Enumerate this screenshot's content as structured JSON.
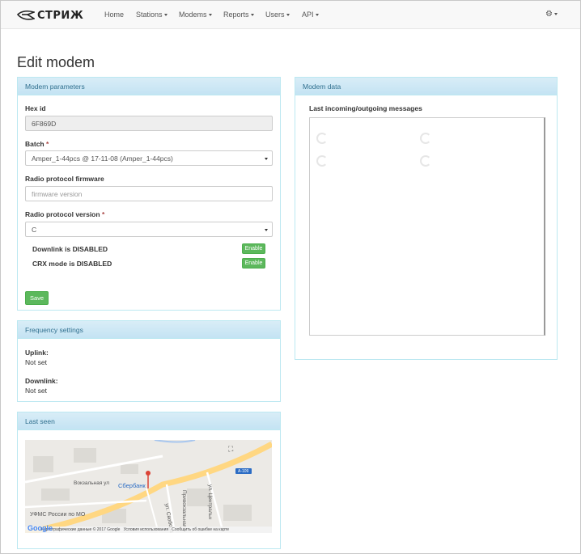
{
  "brand": {
    "name": "СТРИЖ"
  },
  "nav": {
    "items": [
      {
        "label": "Home",
        "has_caret": false
      },
      {
        "label": "Stations",
        "has_caret": true
      },
      {
        "label": "Modems",
        "has_caret": true
      },
      {
        "label": "Reports",
        "has_caret": true
      },
      {
        "label": "Users",
        "has_caret": true
      },
      {
        "label": "API",
        "has_caret": true
      }
    ],
    "settings_icon": "gear-icon"
  },
  "page": {
    "title": "Edit modem"
  },
  "modem_parameters": {
    "heading": "Modem parameters",
    "hex_id": {
      "label": "Hex id",
      "value": "6F869D"
    },
    "batch": {
      "label": "Batch",
      "required_mark": "*",
      "value": "Amper_1-44pcs @ 17-11-08 (Amper_1-44pcs)"
    },
    "firmware": {
      "label": "Radio protocol firmware",
      "placeholder": "firmware version"
    },
    "protocol_version": {
      "label": "Radio protocol version",
      "required_mark": "*",
      "value": "C"
    },
    "downlink": {
      "status": "Downlink is DISABLED",
      "button": "Enable"
    },
    "crx": {
      "status": "CRX mode is DISABLED",
      "button": "Enable"
    },
    "save_button": "Save"
  },
  "frequency": {
    "heading": "Frequency settings",
    "uplink": {
      "label": "Uplink:",
      "value": "Not set"
    },
    "downlink": {
      "label": "Downlink:",
      "value": "Not set"
    }
  },
  "last_seen": {
    "heading": "Last seen",
    "map": {
      "street_1": "Вокзальная ул",
      "poi_bank": "Сбербанк",
      "poi_fms": "УФМС России по МО",
      "street_2": "ул. Центральн",
      "street_3": "Привокзальная",
      "street_4": "ул. Свобода",
      "road_sign": "А-109",
      "footer_data": "Картографические данные © 2017 Google",
      "footer_terms": "Условия использования",
      "footer_report": "Сообщить об ошибке на карте",
      "logo": "Google"
    }
  },
  "modem_data": {
    "heading": "Modem data",
    "messages_label": "Last incoming/outgoing messages"
  },
  "colors": {
    "panel_heading": "#d9edf7",
    "panel_border": "#bce8f1",
    "panel_text": "#31708f",
    "success": "#5cb85c"
  }
}
